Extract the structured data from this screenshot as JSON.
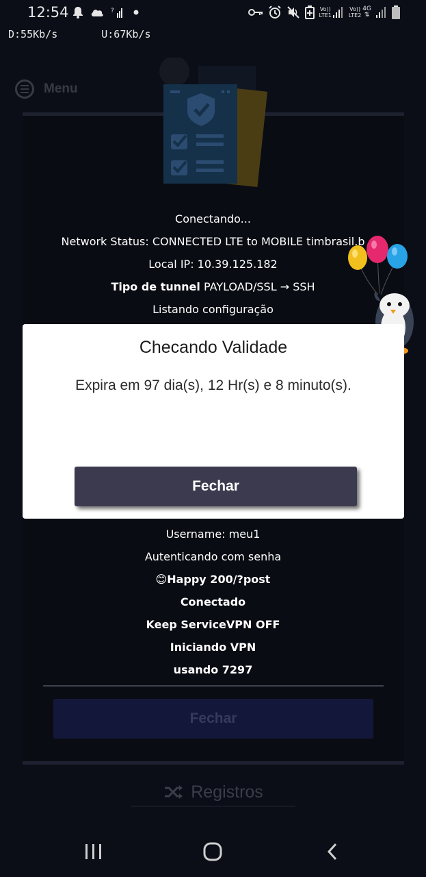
{
  "status_bar": {
    "time": "12:54",
    "left_icons": [
      "notification-bell-icon",
      "cloud-icon",
      "signal-question-icon",
      "dot-icon"
    ],
    "right_icons": [
      "vpn-key-icon",
      "alarm-icon",
      "mute-icon",
      "battery-saver-icon",
      "signal-lte1-icon",
      "signal-lte2-icon",
      "signal-icon",
      "battery-icon"
    ],
    "lte1_label_top": "Vo))",
    "lte1_label_bottom": "LTE1",
    "lte2_label_top": "Vo))",
    "lte2_label_bottom": "LTE2",
    "net_label": "4G"
  },
  "speed": {
    "download": "D:55Kb/s",
    "upload": "U:67Kb/s"
  },
  "app": {
    "menu_label": "Menu",
    "log": [
      "Conectando...",
      "Network Status: CONNECTED LTE to MOBILE timbrasil.b",
      "Local IP: 10.39.125.182",
      "Tipo de tunnel PAYLOAD/SSL → SSH",
      "Listando configuração",
      "Username: meu1",
      "Autenticando com senha",
      "😊Happy 200/?post",
      "Conectado",
      "Keep ServiceVPN OFF",
      "Iniciando VPN",
      "usando 7297"
    ],
    "log_tunnel_label": "Tipo de tunnel",
    "log_tunnel_value": "PAYLOAD/SSL → SSH",
    "close_button": "Fechar",
    "logs_button": "Registros"
  },
  "modal": {
    "title": "Checando Validade",
    "message": "Expira em 97 dia(s), 12 Hr(s) e 8 minuto(s).",
    "close_button": "Fechar"
  },
  "colors": {
    "background": "#0b0e17",
    "modal_button": "#3b3a4f",
    "dim_button": "#13183a"
  }
}
